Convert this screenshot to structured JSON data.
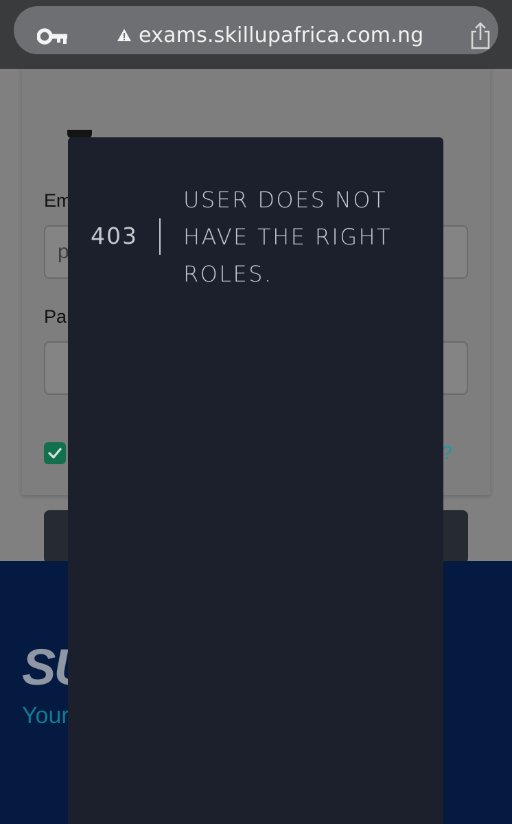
{
  "browser": {
    "url": "exams.skillupafrica.com.ng",
    "icons": {
      "left": "key-icon",
      "security": "warning-icon",
      "right": "share-icon"
    }
  },
  "login_form": {
    "email_label": "Email / User Name",
    "email_value": "p",
    "password_label": "Pa",
    "forgot_link": "rd?",
    "remember_checked": true
  },
  "footer": {
    "logo": "SU",
    "tagline": "Your"
  },
  "error": {
    "code": "403",
    "message": "USER DOES NOT HAVE THE RIGHT ROLES."
  },
  "colors": {
    "chrome": "#3a3b3d",
    "urlbar": "#6e6f72",
    "overlay": "#1c202c",
    "footer": "#041a40",
    "accent": "#1b98a6",
    "checkbox": "#13704e"
  }
}
